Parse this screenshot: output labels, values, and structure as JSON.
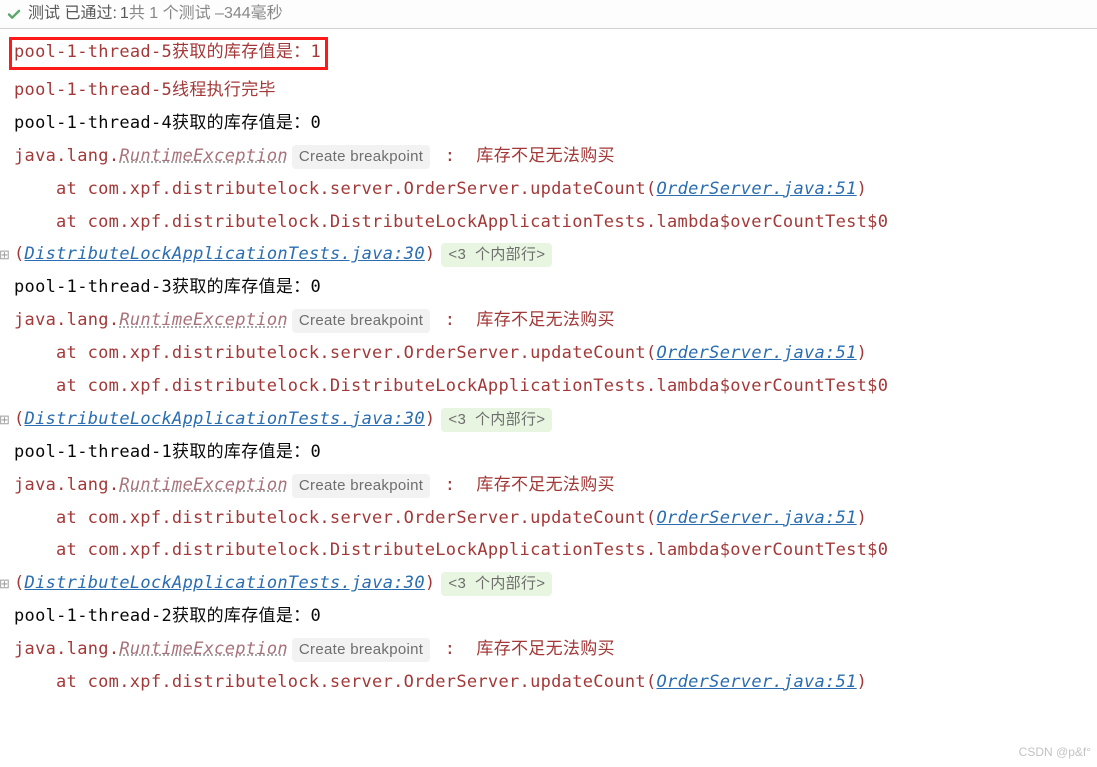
{
  "header": {
    "label_prefix": "测试 已通过:",
    "passed": "1",
    "joiner": "共 1 个测试 – ",
    "duration": "344毫秒"
  },
  "gutter": {
    "expand_glyph": "⊞"
  },
  "bp_label": "Create breakpoint",
  "fold_label": "<3  个内部行>",
  "messages": {
    "stock_prefix": "获取的库存值是：",
    "done_suffix": "线程执行完毕",
    "err_msg": "库存不足无法购买",
    "colon_sep": " :  "
  },
  "exc": {
    "pkg": "java.lang.",
    "cls": "RuntimeException"
  },
  "trace": {
    "at_order": "at com.xpf.distributelock.server.OrderServer.updateCount(",
    "order_link": "OrderServer.java:51",
    "at_lambda": "at com.xpf.distributelock.DistributeLockApplicationTests.lambda$overCountTest$0",
    "paren_open": "(",
    "test_link": "DistributeLockApplicationTests.java:30",
    "paren_close": ")"
  },
  "threads": {
    "t5": "pool-1-thread-5",
    "t4": "pool-1-thread-4",
    "t3": "pool-1-thread-3",
    "t1": "pool-1-thread-1",
    "t2": "pool-1-thread-2"
  },
  "stock": {
    "one": "1",
    "zero": "0"
  },
  "watermark": "CSDN @p&f°"
}
